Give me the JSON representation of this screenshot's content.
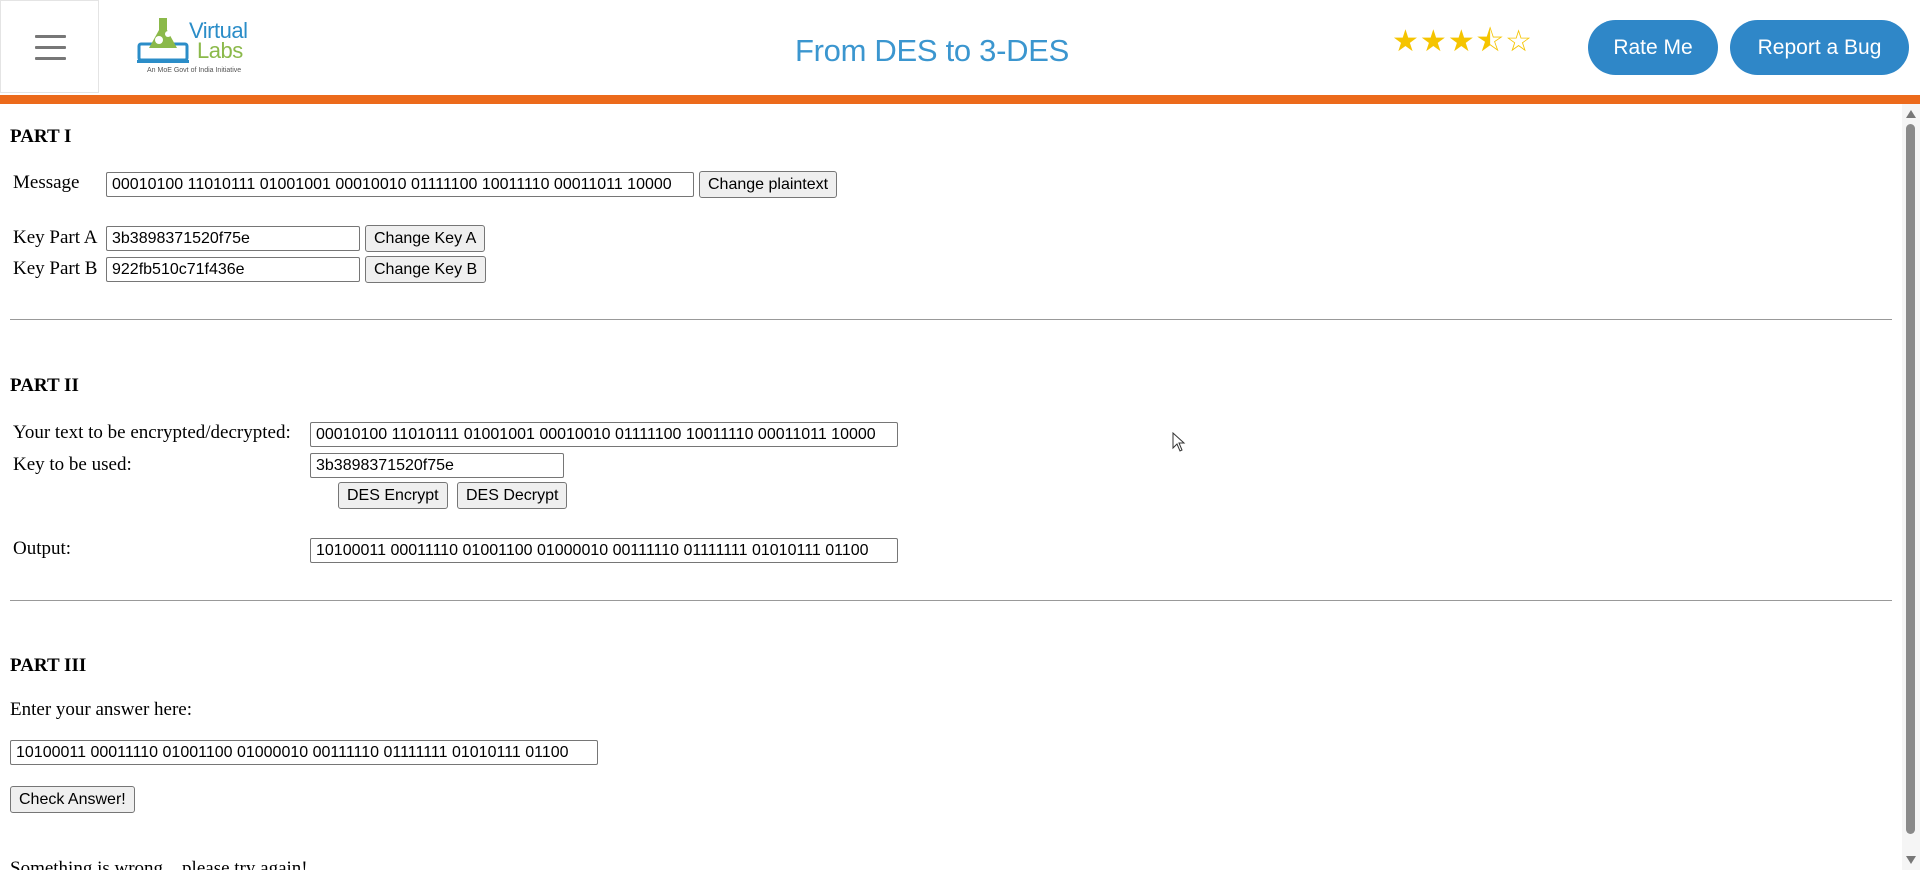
{
  "header": {
    "logo": {
      "line1": "Virtual",
      "line2": "Labs",
      "tagline": "An MoE Govt of India Initiative"
    },
    "title": "From DES to 3-DES",
    "rating": {
      "value": 3.5,
      "max": 5
    },
    "rate_button": "Rate Me",
    "bug_button": "Report a Bug"
  },
  "part1": {
    "heading": "PART I",
    "message_label": "Message",
    "message_value": "00010100 11010111 01001001 00010010 01111100 10011110 00011011 10000",
    "change_plaintext": "Change plaintext",
    "key_a_label": "Key Part A",
    "key_a_value": "3b3898371520f75e",
    "change_key_a": "Change Key A",
    "key_b_label": "Key Part B",
    "key_b_value": "922fb510c71f436e",
    "change_key_b": "Change Key B"
  },
  "part2": {
    "heading": "PART II",
    "text_label": "Your text to be encrypted/decrypted:",
    "text_value": "00010100 11010111 01001001 00010010 01111100 10011110 00011011 10000",
    "key_label": "Key to be used:",
    "key_value": "3b3898371520f75e",
    "encrypt_button": "DES Encrypt",
    "decrypt_button": "DES Decrypt",
    "output_label": "Output:",
    "output_value": "10100011 00011110 01001100 01000010 00111110 01111111 01010111 01100"
  },
  "part3": {
    "heading": "PART III",
    "prompt": "Enter your answer here:",
    "answer_value": "10100011 00011110 01001100 01000010 00111110 01111111 01010111 01100",
    "check_button": "Check Answer!",
    "result": "Something is wrong... please try again!"
  }
}
